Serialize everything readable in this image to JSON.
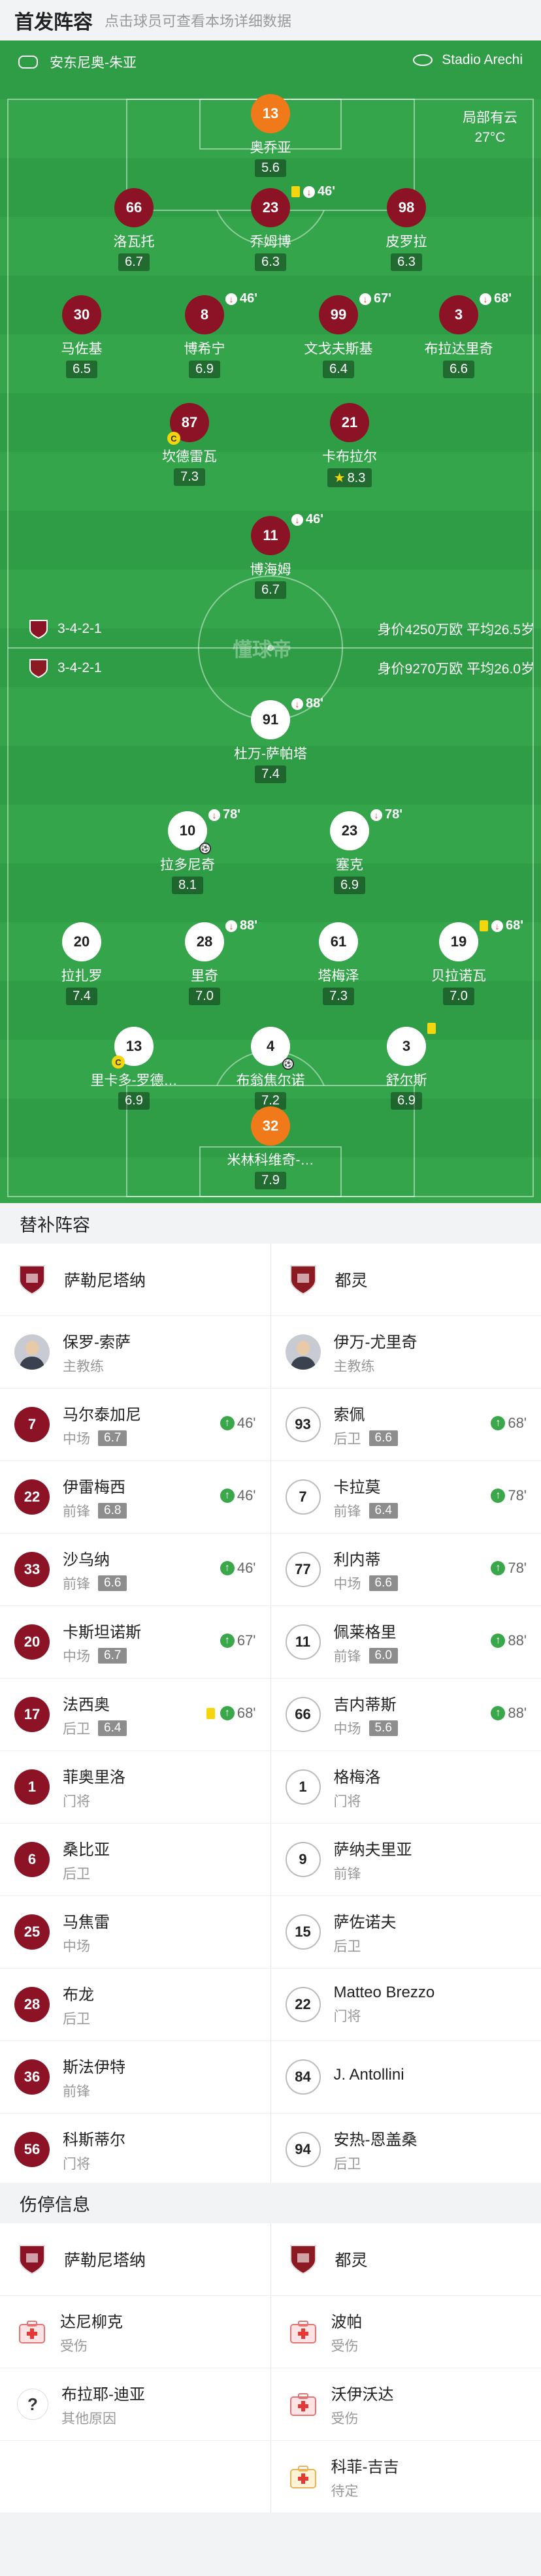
{
  "header": {
    "title": "首发阵容",
    "subtitle": "点击球员可查看本场详细数据"
  },
  "match": {
    "referee_icon": "whistle-icon",
    "referee": "安东尼奥-朱亚",
    "stadium_icon": "stadium-icon",
    "stadium": "Stadio Arechi",
    "weather": "局部有云",
    "temperature": "27°C"
  },
  "home_bar": {
    "formation": "3-4-2-1",
    "value_text": "身价4250万欧 平均26.5岁"
  },
  "away_bar": {
    "formation": "3-4-2-1",
    "value_text": "身价9270万欧 平均26.0岁"
  },
  "watermark": "懂球帝",
  "home_players": [
    {
      "num": "13",
      "name": "奥乔亚",
      "rating": "5.6",
      "gk": true
    },
    {
      "num": "66",
      "name": "洛瓦托",
      "rating": "6.7"
    },
    {
      "num": "23",
      "name": "乔姆博",
      "rating": "6.3",
      "event": "46'",
      "yellow": true
    },
    {
      "num": "98",
      "name": "皮罗拉",
      "rating": "6.3"
    },
    {
      "num": "30",
      "name": "马佐基",
      "rating": "6.5"
    },
    {
      "num": "8",
      "name": "博希宁",
      "rating": "6.9",
      "event": "46'"
    },
    {
      "num": "99",
      "name": "文戈夫斯基",
      "rating": "6.4",
      "event": "67'"
    },
    {
      "num": "3",
      "name": "布拉达里奇",
      "rating": "6.6",
      "event": "68'"
    },
    {
      "num": "87",
      "name": "坎德雷瓦",
      "rating": "7.3",
      "captain": "C"
    },
    {
      "num": "21",
      "name": "卡布拉尔",
      "rating": "8.3",
      "star": true
    },
    {
      "num": "11",
      "name": "博海姆",
      "rating": "6.7",
      "event": "46'"
    }
  ],
  "away_players": [
    {
      "num": "91",
      "name": "杜万-萨帕塔",
      "rating": "7.4",
      "event": "88'"
    },
    {
      "num": "10",
      "name": "拉多尼奇",
      "rating": "8.1",
      "event": "78'",
      "goals": true
    },
    {
      "num": "23",
      "name": "塞克",
      "rating": "6.9",
      "event": "78'"
    },
    {
      "num": "20",
      "name": "拉扎罗",
      "rating": "7.4"
    },
    {
      "num": "28",
      "name": "里奇",
      "rating": "7.0",
      "event": "88'"
    },
    {
      "num": "61",
      "name": "塔梅泽",
      "rating": "7.3"
    },
    {
      "num": "19",
      "name": "贝拉诺瓦",
      "rating": "7.0",
      "event": "68'",
      "yellow": true
    },
    {
      "num": "13",
      "name": "里卡多-罗德…",
      "rating": "6.9",
      "captain": "C"
    },
    {
      "num": "4",
      "name": "布翁焦尔诺",
      "rating": "7.2",
      "goals": true
    },
    {
      "num": "3",
      "name": "舒尔斯",
      "rating": "6.9",
      "yellow": true
    },
    {
      "num": "32",
      "name": "米林科维奇-…",
      "rating": "7.9",
      "gk": true
    }
  ],
  "subs": {
    "title": "替补阵容",
    "home_team": "萨勒尼塔纳",
    "away_team": "都灵",
    "home_coach": {
      "name": "保罗-索萨",
      "role": "主教练"
    },
    "away_coach": {
      "name": "伊万-尤里奇",
      "role": "主教练"
    },
    "home": [
      {
        "num": "7",
        "name": "马尔泰加尼",
        "pos": "中场",
        "rating": "6.7",
        "in": "46'"
      },
      {
        "num": "22",
        "name": "伊雷梅西",
        "pos": "前锋",
        "rating": "6.8",
        "in": "46'"
      },
      {
        "num": "33",
        "name": "沙乌纳",
        "pos": "前锋",
        "rating": "6.6",
        "in": "46'"
      },
      {
        "num": "20",
        "name": "卡斯坦诺斯",
        "pos": "中场",
        "rating": "6.7",
        "in": "67'"
      },
      {
        "num": "17",
        "name": "法西奥",
        "pos": "后卫",
        "rating": "6.4",
        "in": "68'",
        "yellow": true
      },
      {
        "num": "1",
        "name": "菲奥里洛",
        "pos": "门将"
      },
      {
        "num": "6",
        "name": "桑比亚",
        "pos": "后卫"
      },
      {
        "num": "25",
        "name": "马焦雷",
        "pos": "中场"
      },
      {
        "num": "28",
        "name": "布龙",
        "pos": "后卫"
      },
      {
        "num": "36",
        "name": "斯法伊特",
        "pos": "前锋"
      },
      {
        "num": "56",
        "name": "科斯蒂尔",
        "pos": "门将"
      }
    ],
    "away": [
      {
        "num": "93",
        "name": "索佩",
        "pos": "后卫",
        "rating": "6.6",
        "in": "68'"
      },
      {
        "num": "7",
        "name": "卡拉莫",
        "pos": "前锋",
        "rating": "6.4",
        "in": "78'"
      },
      {
        "num": "77",
        "name": "利内蒂",
        "pos": "中场",
        "rating": "6.6",
        "in": "78'"
      },
      {
        "num": "11",
        "name": "佩莱格里",
        "pos": "前锋",
        "rating": "6.0",
        "in": "88'"
      },
      {
        "num": "66",
        "name": "吉内蒂斯",
        "pos": "中场",
        "rating": "5.6",
        "in": "88'"
      },
      {
        "num": "1",
        "name": "格梅洛",
        "pos": "门将"
      },
      {
        "num": "9",
        "name": "萨纳夫里亚",
        "pos": "前锋"
      },
      {
        "num": "15",
        "name": "萨佐诺夫",
        "pos": "后卫"
      },
      {
        "num": "22",
        "name": "Matteo Brezzo",
        "pos": "门将"
      },
      {
        "num": "84",
        "name": "J. Antollini",
        "pos": ""
      },
      {
        "num": "94",
        "name": "安热-恩盖桑",
        "pos": "后卫"
      }
    ]
  },
  "injuries": {
    "title": "伤停信息",
    "home_team": "萨勒尼塔纳",
    "away_team": "都灵",
    "home": [
      {
        "name": "达尼柳克",
        "reason": "受伤",
        "icon": "medical-kit-icon"
      },
      {
        "name": "布拉耶-迪亚",
        "reason": "其他原因",
        "icon": "question-icon"
      }
    ],
    "away": [
      {
        "name": "波帕",
        "reason": "受伤",
        "icon": "medical-kit-icon"
      },
      {
        "name": "沃伊沃达",
        "reason": "受伤",
        "icon": "medical-kit-icon"
      },
      {
        "name": "科菲-吉吉",
        "reason": "待定",
        "icon": "medical-kit-pending-icon"
      }
    ]
  },
  "colors": {
    "home": "#8c1226",
    "pitch": "#2f9d46",
    "gk": "#f07a1a",
    "sub_in": "#3aa84a"
  }
}
